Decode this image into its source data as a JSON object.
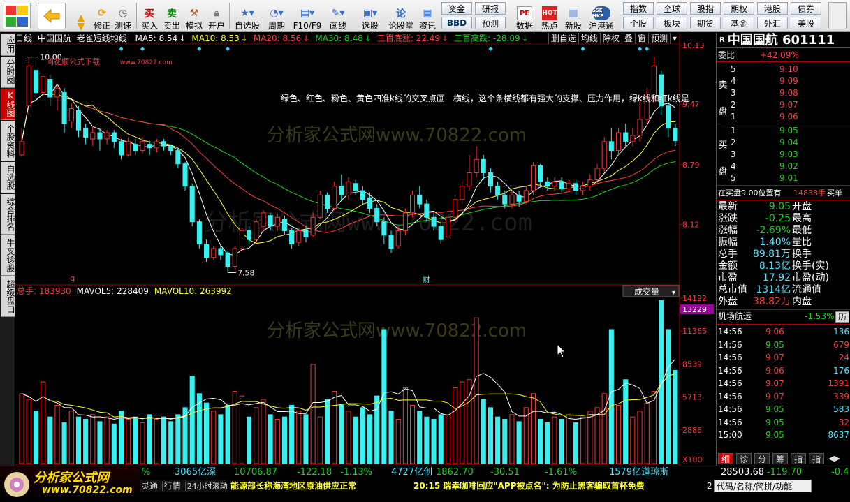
{
  "toolbar": {
    "buttons": [
      {
        "id": "fix",
        "label": "修正"
      },
      {
        "id": "test",
        "label": "测速"
      },
      {
        "id": "buy",
        "label": "买入",
        "icon": "买"
      },
      {
        "id": "sell",
        "label": "卖出",
        "icon": "卖"
      },
      {
        "id": "sim",
        "label": "模拟"
      },
      {
        "id": "open",
        "label": "开户"
      },
      {
        "id": "selfsel",
        "label": "自选股"
      },
      {
        "id": "period",
        "label": "周期"
      },
      {
        "id": "f10",
        "label": "F10/F9"
      },
      {
        "id": "draw",
        "label": "画线"
      },
      {
        "id": "pick",
        "label": "选股"
      },
      {
        "id": "forum",
        "label": "论股堂",
        "icon": "论"
      },
      {
        "id": "news",
        "label": "资讯"
      },
      {
        "id": "data",
        "label": "数据",
        "icon": "PE"
      },
      {
        "id": "hot",
        "label": "热点"
      },
      {
        "id": "newstock",
        "label": "新股"
      },
      {
        "id": "shhk",
        "label": "沪港通",
        "icon": "SSE HKE"
      }
    ],
    "small_buttons": {
      "row1": [
        "资金",
        "研报",
        "指数",
        "全球",
        "股指",
        "期权",
        "港股",
        "债券"
      ],
      "row2": [
        "BBD",
        "预测",
        "个股",
        "板块",
        "期货",
        "基金",
        "外汇",
        "美股"
      ]
    }
  },
  "leftbar": [
    "应用",
    "分时图",
    "K线图",
    "个股资料",
    "自选股",
    "综合排名",
    "牛叉诊股",
    "超级盘口"
  ],
  "chart": {
    "period": "日线",
    "stock_name": "中国国航",
    "formula": "老雀短线均线",
    "ma": [
      {
        "label": "MA5: 8.54",
        "color": "#ffffff"
      },
      {
        "label": "MA10: 8.53",
        "color": "#ffff3a"
      },
      {
        "label": "MA20: 8.56",
        "color": "#ff3c3c"
      },
      {
        "label": "MA30: 8.48",
        "color": "#1fd41f"
      },
      {
        "label": "三百底涨: 22.49",
        "color": "#ff3c3c"
      },
      {
        "label": "三百高跌: -28.09",
        "color": "#1fd41f"
      }
    ],
    "chart_buttons": [
      "删自选",
      "均线",
      "除权",
      "叠",
      "窗",
      "预测"
    ],
    "price_axis": [
      "10.13",
      "9.47",
      "8.79",
      "8.12"
    ],
    "price_range": [
      7.45,
      10.13
    ],
    "high_label": "10.00",
    "low_label": "7.58",
    "ad_text": "问花顺公式下载",
    "ad_url": "www.70822.com",
    "note_text": "绿色、红色、粉色、黄色四准k线的交叉点画一横线，这个条横线都有强大的支撑、压力作用，绿k线和红k线是",
    "watermark": "分析家公式网www.70822.com",
    "watermark2": "分析家公式网www.70822.com",
    "watermark3": "分析家公式网www.70822.com",
    "marker_q": "q",
    "marker_cai": "财",
    "vol_info": {
      "total": "总手: 183930",
      "mavol5": "MAVOL5: 228409",
      "mavol10": "MAVOL10: 263992",
      "indicator": "成交量"
    },
    "vol_axis": [
      "14192",
      "11365",
      "8539",
      "5713",
      "2886",
      "X100"
    ],
    "vol_highlight": "13229",
    "vol_max": 14192
  },
  "chart_data": {
    "type": "candlestick",
    "title": "中国国航 日线",
    "ylim": [
      7.45,
      10.13
    ],
    "candles": [
      [
        8.9,
        9.05,
        8.88,
        9.2
      ],
      [
        9.45,
        9.9,
        9.35,
        10.0
      ],
      [
        9.85,
        9.6,
        9.5,
        9.95
      ],
      [
        9.6,
        9.78,
        9.55,
        9.82
      ],
      [
        9.75,
        9.55,
        9.45,
        9.8
      ],
      [
        9.55,
        9.65,
        9.4,
        9.7
      ],
      [
        9.6,
        9.25,
        9.15,
        9.65
      ],
      [
        9.28,
        9.42,
        9.2,
        9.48
      ],
      [
        9.4,
        9.18,
        9.1,
        9.45
      ],
      [
        9.2,
        9.1,
        9.02,
        9.25
      ],
      [
        9.08,
        9.15,
        9.0,
        9.22
      ],
      [
        9.15,
        9.08,
        8.95,
        9.2
      ],
      [
        9.08,
        9.15,
        9.02,
        9.18
      ],
      [
        9.15,
        9.05,
        8.98,
        9.18
      ],
      [
        9.05,
        8.9,
        8.85,
        9.08
      ],
      [
        8.9,
        9.05,
        8.88,
        9.1
      ],
      [
        9.02,
        8.95,
        8.9,
        9.08
      ],
      [
        8.95,
        9.05,
        8.92,
        9.1
      ],
      [
        9.02,
        8.98,
        8.9,
        9.06
      ],
      [
        8.98,
        9.05,
        8.93,
        9.08
      ],
      [
        9.05,
        9.0,
        8.95,
        9.08
      ],
      [
        9.0,
        8.95,
        8.9,
        9.02
      ],
      [
        8.95,
        8.8,
        8.75,
        8.98
      ],
      [
        8.8,
        8.55,
        8.5,
        8.82
      ],
      [
        8.55,
        8.15,
        8.1,
        8.58
      ],
      [
        8.15,
        7.9,
        7.85,
        8.18
      ],
      [
        7.9,
        7.75,
        7.7,
        7.95
      ],
      [
        7.75,
        7.85,
        7.72,
        7.88
      ],
      [
        7.85,
        7.78,
        7.72,
        7.9
      ],
      [
        7.8,
        7.65,
        7.58,
        7.82
      ],
      [
        7.65,
        7.85,
        7.62,
        7.88
      ],
      [
        7.85,
        8.05,
        7.82,
        8.08
      ],
      [
        8.05,
        7.95,
        7.9,
        8.1
      ],
      [
        7.95,
        8.15,
        7.92,
        8.18
      ],
      [
        8.1,
        8.25,
        8.05,
        8.28
      ],
      [
        8.22,
        8.1,
        8.05,
        8.25
      ],
      [
        8.1,
        8.2,
        8.05,
        8.24
      ],
      [
        8.18,
        8.05,
        8.0,
        8.22
      ],
      [
        8.05,
        7.9,
        7.85,
        8.08
      ],
      [
        7.92,
        8.05,
        7.88,
        8.08
      ],
      [
        8.05,
        7.98,
        7.92,
        8.1
      ],
      [
        8.0,
        8.2,
        7.98,
        8.25
      ],
      [
        8.2,
        8.45,
        8.18,
        8.5
      ],
      [
        8.45,
        8.3,
        8.25,
        8.48
      ],
      [
        8.3,
        8.55,
        8.28,
        8.6
      ],
      [
        8.55,
        8.45,
        8.38,
        8.68
      ],
      [
        8.45,
        8.6,
        8.4,
        8.65
      ],
      [
        8.58,
        8.5,
        8.45,
        8.62
      ],
      [
        8.5,
        8.4,
        8.35,
        8.55
      ],
      [
        8.42,
        8.3,
        8.25,
        8.48
      ],
      [
        8.3,
        8.15,
        8.1,
        8.35
      ],
      [
        8.15,
        8.0,
        7.9,
        8.2
      ],
      [
        8.0,
        7.85,
        7.8,
        8.05
      ],
      [
        7.88,
        8.05,
        7.85,
        8.1
      ],
      [
        8.05,
        8.25,
        8.0,
        8.3
      ],
      [
        8.25,
        8.45,
        8.2,
        8.5
      ],
      [
        8.45,
        8.35,
        8.3,
        8.55
      ],
      [
        8.35,
        8.2,
        8.15,
        8.4
      ],
      [
        8.2,
        8.1,
        8.05,
        8.25
      ],
      [
        8.1,
        7.95,
        7.9,
        8.15
      ],
      [
        7.98,
        8.2,
        7.95,
        8.25
      ],
      [
        8.2,
        8.4,
        8.15,
        8.45
      ],
      [
        8.4,
        8.55,
        8.35,
        8.6
      ],
      [
        8.55,
        8.7,
        8.5,
        8.9
      ],
      [
        8.7,
        8.85,
        8.65,
        9.0
      ],
      [
        8.85,
        8.7,
        8.62,
        8.9
      ],
      [
        8.7,
        8.55,
        8.48,
        8.75
      ],
      [
        8.55,
        8.45,
        8.4,
        8.6
      ],
      [
        8.45,
        8.35,
        8.3,
        8.5
      ],
      [
        8.35,
        8.45,
        8.3,
        8.5
      ],
      [
        8.45,
        8.38,
        8.32,
        8.5
      ],
      [
        8.38,
        8.5,
        8.35,
        8.55
      ],
      [
        8.5,
        8.78,
        8.45,
        8.82
      ],
      [
        8.78,
        8.6,
        8.55,
        8.8
      ],
      [
        8.6,
        8.55,
        8.5,
        8.65
      ],
      [
        8.55,
        8.6,
        8.5,
        8.65
      ],
      [
        8.6,
        8.52,
        8.48,
        8.65
      ],
      [
        8.52,
        8.58,
        8.48,
        8.62
      ],
      [
        8.58,
        8.5,
        8.45,
        8.62
      ],
      [
        8.5,
        8.55,
        8.45,
        8.6
      ],
      [
        8.55,
        8.62,
        8.5,
        8.68
      ],
      [
        8.62,
        8.75,
        8.58,
        8.8
      ],
      [
        8.75,
        9.05,
        8.7,
        9.1
      ],
      [
        9.05,
        8.95,
        8.85,
        9.2
      ],
      [
        8.95,
        9.15,
        8.9,
        9.2
      ],
      [
        9.15,
        9.05,
        8.98,
        9.25
      ],
      [
        9.05,
        9.12,
        9.0,
        9.2
      ],
      [
        9.12,
        9.3,
        9.05,
        9.5
      ],
      [
        9.3,
        9.55,
        9.25,
        9.65
      ],
      [
        9.55,
        9.9,
        9.5,
        10.0
      ],
      [
        9.8,
        9.45,
        9.35,
        9.85
      ],
      [
        9.45,
        9.2,
        9.1,
        9.5
      ],
      [
        9.2,
        9.06,
        9.0,
        9.25
      ]
    ],
    "volumes": [
      60,
      55,
      45,
      70,
      40,
      50,
      35,
      45,
      40,
      38,
      42,
      36,
      40,
      34,
      45,
      38,
      40,
      35,
      42,
      38,
      40,
      36,
      42,
      48,
      75,
      60,
      52,
      45,
      42,
      50,
      62,
      58,
      40,
      48,
      55,
      42,
      38,
      40,
      50,
      45,
      42,
      85,
      40,
      55,
      62,
      50,
      45,
      40,
      48,
      42,
      58,
      115,
      45,
      38,
      65,
      50,
      45,
      40,
      38,
      42,
      42,
      65,
      70,
      72,
      125,
      55,
      48,
      40,
      38,
      42,
      36,
      48,
      60,
      38,
      35,
      40,
      38,
      42,
      35,
      40,
      45,
      48,
      60,
      115,
      50,
      72,
      40,
      45,
      52,
      62,
      140,
      115,
      80
    ]
  },
  "right_panel": {
    "title": "中国国航 601111",
    "title_prefix": "R",
    "weibi_label": "委比",
    "weibi_value": "+42.09%",
    "sell_label": [
      "卖",
      "盘"
    ],
    "buy_label": [
      "买",
      "盘"
    ],
    "sell": [
      [
        "5",
        "9.10"
      ],
      [
        "4",
        "9.09"
      ],
      [
        "3",
        "9.08"
      ],
      [
        "2",
        "9.07"
      ],
      [
        "1",
        "9.06"
      ]
    ],
    "buy": [
      [
        "1",
        "9.05"
      ],
      [
        "2",
        "9.04"
      ],
      [
        "3",
        "9.03"
      ],
      [
        "4",
        "9.02"
      ],
      [
        "5",
        "9.01"
      ]
    ],
    "pos_text": "在买盘9.00位置有",
    "pos_qty": "14838手",
    "pos_suffix": "买单",
    "quotes": [
      [
        "最新",
        "9.05",
        "开盘",
        ""
      ],
      [
        "涨跌",
        "-0.25",
        "最高",
        ""
      ],
      [
        "涨幅",
        "-2.69%",
        "最低",
        ""
      ],
      [
        "振幅",
        "1.40%",
        "量比",
        ""
      ],
      [
        "总手",
        "89.81万",
        "换手",
        ""
      ],
      [
        "金额",
        "8.13亿",
        "换手(实)",
        ""
      ],
      [
        "市盈",
        "17.92",
        "市盈(动)",
        ""
      ],
      [
        "总市值",
        "1314亿",
        "流通值",
        ""
      ],
      [
        "外盘",
        "38.82万",
        "内盘",
        ""
      ]
    ],
    "sector": "机场航运",
    "sector_change": "-1.53%",
    "sector_btn": "历",
    "ticks": [
      [
        "14:56",
        "9.06",
        "136"
      ],
      [
        "14:56",
        "9.05",
        "679"
      ],
      [
        "14:56",
        "9.07",
        "24"
      ],
      [
        "14:56",
        "9.06",
        "176"
      ],
      [
        "14:56",
        "9.07",
        "1391"
      ],
      [
        "14:56",
        "9.07",
        "339"
      ],
      [
        "14:56",
        "9.05",
        "583"
      ],
      [
        "14:56",
        "9.05",
        "32"
      ],
      [
        "15:00",
        "9.05",
        "8637"
      ]
    ],
    "tabs": [
      "细",
      "诊",
      "分",
      "筹",
      "指",
      "指"
    ]
  },
  "bottom": {
    "ticker": [
      {
        "text": "%",
        "color": "#1fd41f"
      },
      {
        "text": "3065亿深",
        "color": "#4fe6ff"
      },
      {
        "text": "10706.87",
        "color": "#1fd41f"
      },
      {
        "text": "-122.18",
        "color": "#1fd41f"
      },
      {
        "text": "-1.13%",
        "color": "#1fd41f"
      },
      {
        "text": "4727亿创",
        "color": "#4fe6ff"
      },
      {
        "text": "1862.70",
        "color": "#1fd41f"
      },
      {
        "text": "-30.51",
        "color": "#1fd41f"
      },
      {
        "text": "-1.61%",
        "color": "#1fd41f"
      },
      {
        "text": "1579亿道琼斯",
        "color": "#4fe6ff"
      },
      {
        "text": "28503.68",
        "color": "#ffffff"
      },
      {
        "text": "-119.70",
        "color": "#1fd41f"
      },
      {
        "text": "-0.4",
        "color": "#1fd41f"
      }
    ],
    "tabs": [
      "灵通",
      "行情",
      "24小时滚动"
    ],
    "news1": "能源部长称海湾地区原油供应正常",
    "news2": "20:15 瑞幸咖啡回应\"APP被点名\": 为防止黑客骗取首杯免费",
    "num": "2",
    "code_btn": "代码/名称/简拼/功能",
    "logo_name": "分析家公式网",
    "logo_url": "www.70822.com"
  }
}
